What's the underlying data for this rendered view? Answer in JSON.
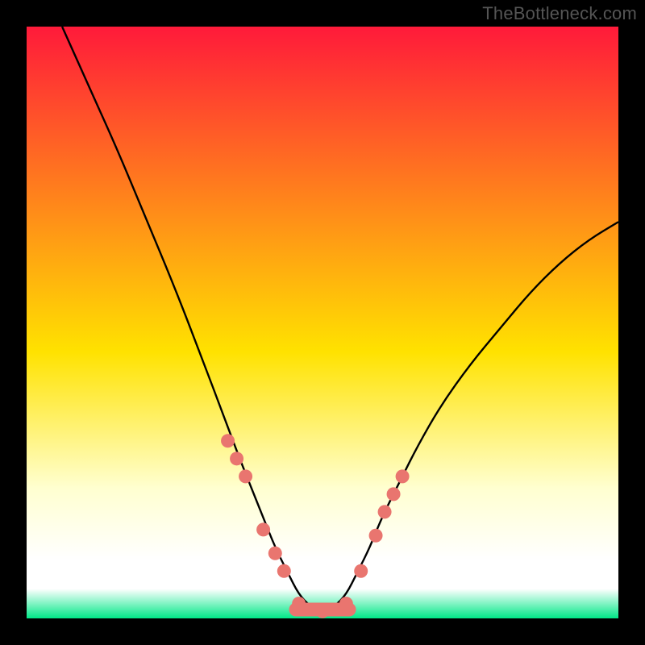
{
  "watermark": "TheBottleneck.com",
  "colors": {
    "frame": "#000000",
    "curve": "#000000",
    "marker_fill": "#e9756f",
    "marker_stroke": "#c9524c",
    "grad_top": "#ff1a3a",
    "grad_yellow": "#ffe200",
    "grad_pale": "#ffffd0",
    "grad_white": "#ffffff",
    "grad_green": "#00e887"
  },
  "plot": {
    "inner_x": 33,
    "inner_y": 33,
    "inner_w": 734,
    "inner_h": 734
  },
  "chart_data": {
    "type": "line",
    "title": "",
    "xlabel": "",
    "ylabel": "",
    "xlim": [
      0,
      100
    ],
    "ylim": [
      0,
      100
    ],
    "grid": false,
    "legend": false,
    "note": "Scales are not labeled in the image; x and y are normalized 0–100 estimates read from pixel positions. y=0 at bottom, x=0 at left.",
    "series": [
      {
        "name": "curve",
        "x": [
          6,
          10,
          15,
          20,
          25,
          30,
          33,
          36,
          38,
          40,
          42,
          44,
          46,
          48,
          50,
          52,
          54,
          56,
          58,
          60,
          63,
          66,
          70,
          75,
          80,
          85,
          90,
          95,
          100
        ],
        "y": [
          100,
          91,
          80,
          68,
          56,
          43,
          35,
          27,
          22,
          17,
          12,
          8,
          4,
          2,
          1,
          2,
          4,
          8,
          12,
          17,
          23,
          29,
          36,
          43,
          49,
          55,
          60,
          64,
          67
        ]
      }
    ],
    "markers": {
      "name": "highlight-points",
      "x": [
        34,
        35.5,
        37,
        40,
        42,
        43.5,
        46,
        48,
        50,
        52,
        54,
        56.5,
        59,
        60.5,
        62,
        63.5
      ],
      "y": [
        30,
        27,
        24,
        15,
        11,
        8,
        2.5,
        1.5,
        1.2,
        1.5,
        2.5,
        8,
        14,
        18,
        21,
        24
      ],
      "note": "Pink dot markers clustered near the valley of the curve, approximate positions."
    }
  }
}
